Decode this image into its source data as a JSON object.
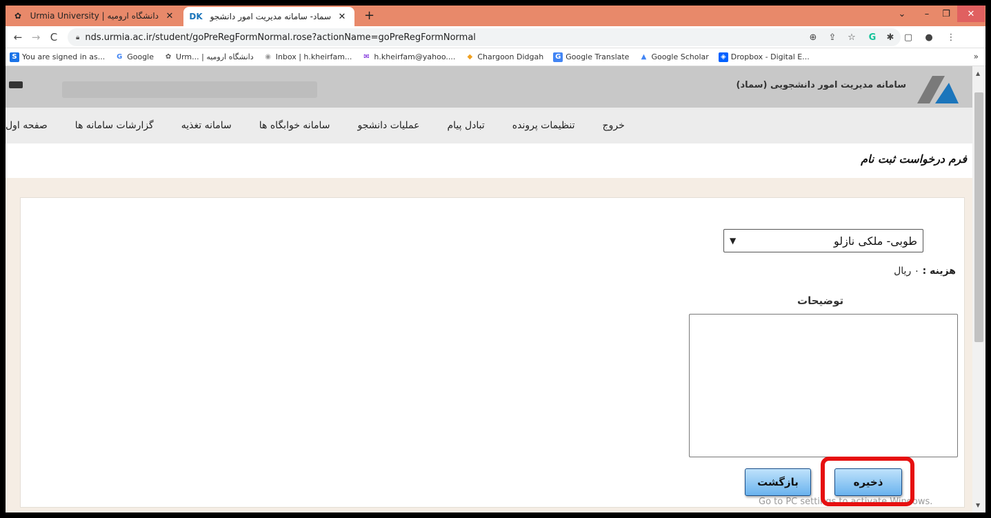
{
  "browser": {
    "tabs": [
      {
        "title": "دانشگاه ارومیه | Urmia University",
        "favicon": "urmia-logo-icon",
        "close": "✕"
      },
      {
        "title": "سماد- سامانه مدیریت امور دانشجو",
        "favicon": "dk-logo-icon",
        "close": "✕"
      }
    ],
    "new_tab": "+",
    "window_controls": {
      "tablist": "⌄",
      "minimize": "–",
      "maximize": "❐",
      "close": "✕"
    },
    "nav": {
      "back": "←",
      "forward": "→",
      "reload": "C"
    },
    "url": "nds.urmia.ac.ir/student/goPreRegFormNormal.rose?actionName=goPreRegFormNormal",
    "bookmarks": [
      {
        "label": "You are signed in as...",
        "icon": "S",
        "color": "#1a73e8"
      },
      {
        "label": "Google",
        "icon": "G",
        "color": "#4285f4"
      },
      {
        "label": "Urm... | دانشگاه ارومیه",
        "icon": "✿",
        "color": "#555555"
      },
      {
        "label": "Inbox | h.kheirfam...",
        "icon": "◉",
        "color": "#999999"
      },
      {
        "label": "h.kheirfam@yahoo....",
        "icon": "✉",
        "color": "#6001d2"
      },
      {
        "label": "Chargoon Didgah",
        "icon": "◆",
        "color": "#f0a020"
      },
      {
        "label": "Google Translate",
        "icon": "G",
        "color": "#4285f4"
      },
      {
        "label": "Google Scholar",
        "icon": "▲",
        "color": "#4285f4"
      },
      {
        "label": "Dropbox - Digital E...",
        "icon": "◈",
        "color": "#0061ff"
      }
    ],
    "bookmarks_more": "»"
  },
  "header": {
    "system_title": "سامانه مدیریت امور دانشجویی (سماد)"
  },
  "navbar": {
    "items": [
      "صفحه اول",
      "گزارشات سامانه ها",
      "سامانه تغذیه",
      "سامانه خوابگاه ها",
      "عملیات دانشجو",
      "تبادل پیام",
      "تنظیمات پرونده",
      "خروج"
    ]
  },
  "form": {
    "title": "فرم درخواست ثبت نام",
    "dorm_selected": "طوبی- ملکی نازلو",
    "cost_label": "هزینه :",
    "cost_value": "۰ ریال",
    "description_label": "توضیحات",
    "description_value": "",
    "save_button": "ذخیره",
    "back_button": "بازگشت"
  },
  "watermark": "Go to PC settings to activate Windows.",
  "colors": {
    "tab_bar": "#e8896a",
    "page_bg": "#f5ede4",
    "button_gradient_top": "#bfe2fb",
    "button_gradient_bottom": "#6ab3ee",
    "highlight": "#e61010"
  }
}
